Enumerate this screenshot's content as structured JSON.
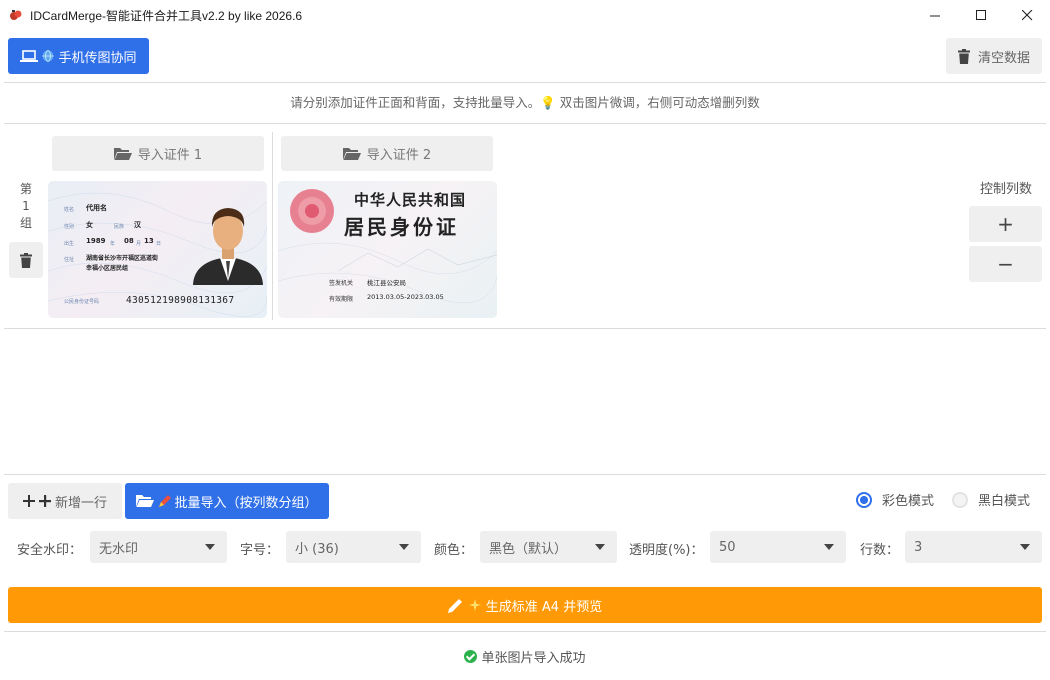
{
  "window": {
    "title": "IDCardMerge-智能证件合并工具v2.2 by like 2026.6",
    "minimize": "—",
    "maximize": "☐",
    "close": "✕"
  },
  "toolbar": {
    "phone_label": "手机传图协同",
    "clear_label": "清空数据"
  },
  "hint": "请分别添加证件正面和背面，支持批量导入。💡 双击图片微调，右侧可动态增删列数",
  "columns": [
    {
      "import_label": "导入证件 1"
    },
    {
      "import_label": "导入证件 2"
    }
  ],
  "group": {
    "label_line1": "第",
    "label_line2": "1",
    "label_line3": "组"
  },
  "card_front": {
    "name_label": "姓名",
    "name": "代用名",
    "gender_label": "性别",
    "gender": "女",
    "ethnicity_label": "民族",
    "ethnicity": "汉",
    "birth_label": "出生",
    "birth_year": "1989",
    "birth_year_unit": "年",
    "birth_month": "08",
    "birth_month_unit": "月",
    "birth_day": "13",
    "birth_day_unit": "日",
    "address_label": "住址",
    "address_line1": "湖南省长沙市开福区巡道街",
    "address_line2": "幸福小区居民组",
    "id_label": "公民身份证号码",
    "id_number": "430512198908131367"
  },
  "card_back": {
    "title1": "中华人民共和国",
    "title2": "居民身份证",
    "authority_label": "签发机关",
    "authority": "桃江县公安局",
    "validity_label": "有效期限",
    "validity": "2013.03.05-2023.03.05"
  },
  "column_control": {
    "label": "控制列数",
    "add": "+",
    "remove": "−"
  },
  "actions": {
    "add_row_label": "新增一行",
    "batch_label": "批量导入（按列数分组）"
  },
  "mode": {
    "color_label": "彩色模式",
    "bw_label": "黑白模式",
    "selected": "color"
  },
  "options": {
    "watermark_label": "安全水印：",
    "watermark_value": "无水印",
    "fontsize_label": "字号：",
    "fontsize_value": "小 (36)",
    "color_label": "颜色：",
    "color_value": "黑色（默认）",
    "opacity_label": "透明度(%)：",
    "opacity_value": "50",
    "rows_label": "行数：",
    "rows_value": "3"
  },
  "generate_label": "生成标准 A4 并预览",
  "status": "单张图片导入成功",
  "colors": {
    "primary": "#2f6fe8",
    "accent": "#ff9a06",
    "success": "#2bb24c",
    "button_gray": "#efefef"
  }
}
